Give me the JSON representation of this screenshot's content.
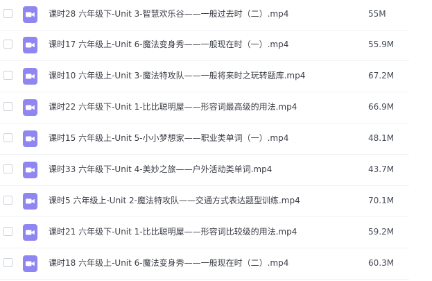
{
  "theme": {
    "icon_color": "#8f86f2",
    "text_color": "#3a3d45",
    "divider_color": "#f1f2f4"
  },
  "files": [
    {
      "name": "课时28 六年级下-Unit 3-智慧欢乐谷——一般过去时（二）.mp4",
      "size": "55M",
      "icon": "video-file-icon"
    },
    {
      "name": "课时17 六年级上-Unit 6-魔法变身秀——一般现在时（一）.mp4",
      "size": "55.9M",
      "icon": "video-file-icon"
    },
    {
      "name": "课时10 六年级上-Unit 3-魔法特攻队——一般将来时之玩转题库.mp4",
      "size": "67.2M",
      "icon": "video-file-icon"
    },
    {
      "name": "课时22 六年级下-Unit 1-比比聪明屋——形容词最高级的用法.mp4",
      "size": "66.9M",
      "icon": "video-file-icon"
    },
    {
      "name": "课时15 六年级上-Unit 5-小小梦想家——职业类单词（一）.mp4",
      "size": "48.1M",
      "icon": "video-file-icon"
    },
    {
      "name": "课时33 六年级下-Unit 4-美妙之旅——户外活动类单词.mp4",
      "size": "43.7M",
      "icon": "video-file-icon"
    },
    {
      "name": "课时5 六年级上-Unit 2-魔法特攻队——交通方式表达题型训练.mp4",
      "size": "70.1M",
      "icon": "video-file-icon"
    },
    {
      "name": "课时21 六年级下-Unit 1-比比聪明屋——形容词比较级的用法.mp4",
      "size": "59.2M",
      "icon": "video-file-icon"
    },
    {
      "name": "课时18 六年级上-Unit 6-魔法变身秀——一般现在时（二）.mp4",
      "size": "60.3M",
      "icon": "video-file-icon"
    }
  ]
}
